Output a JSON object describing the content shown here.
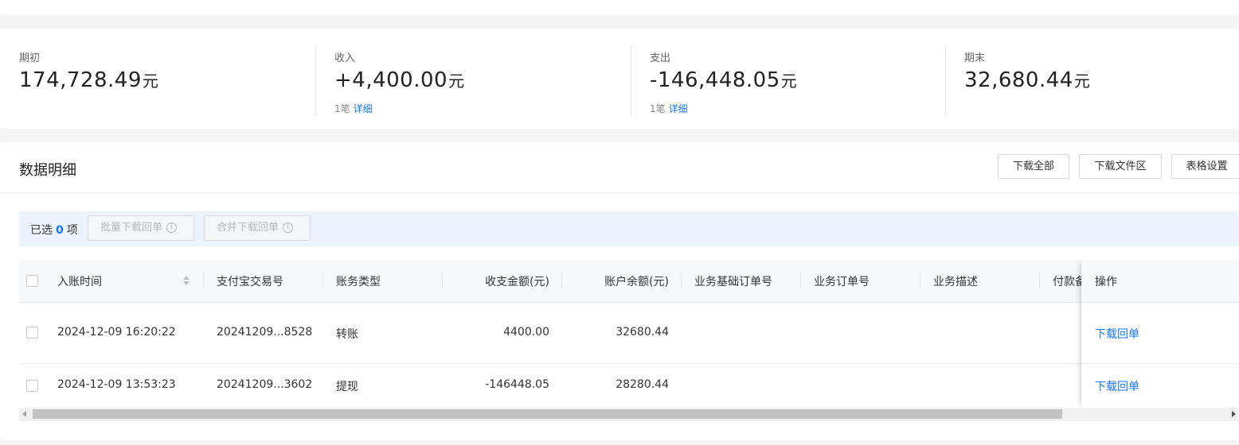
{
  "summary": {
    "opening": {
      "label": "期初",
      "amount": "174,728.49",
      "unit": "元"
    },
    "income": {
      "label": "收入",
      "amount": "+4,400.00",
      "unit": "元",
      "count": "1笔",
      "detail": "详细"
    },
    "expense": {
      "label": "支出",
      "amount": "-146,448.05",
      "unit": "元",
      "count": "1笔",
      "detail": "详细"
    },
    "closing": {
      "label": "期末",
      "amount": "32,680.44",
      "unit": "元"
    }
  },
  "detail": {
    "title": "数据明细",
    "buttons": {
      "download_all": "下载全部",
      "download_area": "下载文件区",
      "table_settings": "表格设置"
    }
  },
  "selection": {
    "prefix": "已选",
    "count": "0",
    "suffix": "项",
    "batch_download": "批量下载回单",
    "merge_download": "合并下载回单",
    "info_icon": "i"
  },
  "table": {
    "columns": [
      "入账时间",
      "支付宝交易号",
      "账务类型",
      "收支金额(元)",
      "账户余额(元)",
      "业务基础订单号",
      "业务订单号",
      "业务描述",
      "付款备",
      "操作"
    ],
    "rows": [
      {
        "time": "2024-12-09 16:20:22",
        "trade_no": "20241209...8528",
        "type": "转账",
        "amount": "4400.00",
        "balance": "32680.44",
        "action": "下载回单"
      },
      {
        "time": "2024-12-09 13:53:23",
        "trade_no": "20241209...3602",
        "type": "提现",
        "amount": "-146448.05",
        "balance": "28280.44",
        "action": "下载回单"
      }
    ]
  },
  "colors": {
    "accent": "#1677ff",
    "selection_bar": "#edf3fd",
    "header_bg": "#f7f8fa"
  }
}
